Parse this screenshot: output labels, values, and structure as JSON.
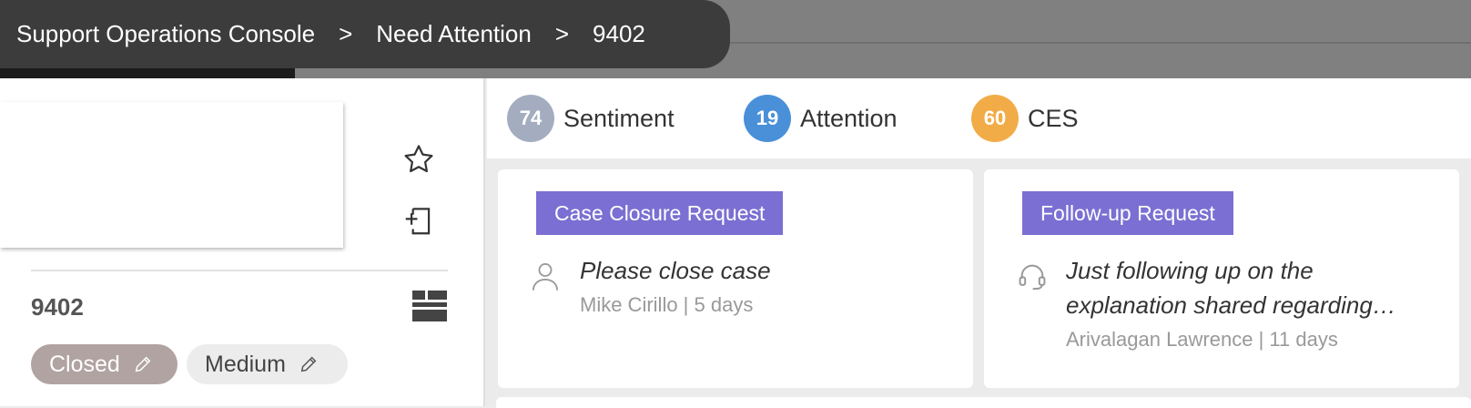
{
  "breadcrumb": {
    "items": [
      "Support Operations Console",
      "Need Attention",
      "9402"
    ],
    "separator": ">"
  },
  "case": {
    "id": "9402",
    "status": "Closed",
    "priority": "Medium"
  },
  "scores": [
    {
      "value": "74",
      "label": "Sentiment",
      "color": "#a3adbf"
    },
    {
      "value": "19",
      "label": "Attention",
      "color": "#4a90d9"
    },
    {
      "value": "60",
      "label": "CES",
      "color": "#f2ac47"
    }
  ],
  "requests": [
    {
      "tag": "Case Closure Request",
      "icon": "person-icon",
      "text_lines": [
        "Please close case"
      ],
      "meta": "Mike Cirillo | 5 days"
    },
    {
      "tag": "Follow-up Request",
      "icon": "headset-icon",
      "text_lines": [
        "Just following up on the",
        "explanation shared regarding…"
      ],
      "meta": "Arivalagan Lawrence | 11 days"
    }
  ],
  "colors": {
    "tag_purple": "#7b6fd3",
    "status_pill": "#b0a3a2",
    "breadcrumb_bg": "#3c3c3c"
  }
}
